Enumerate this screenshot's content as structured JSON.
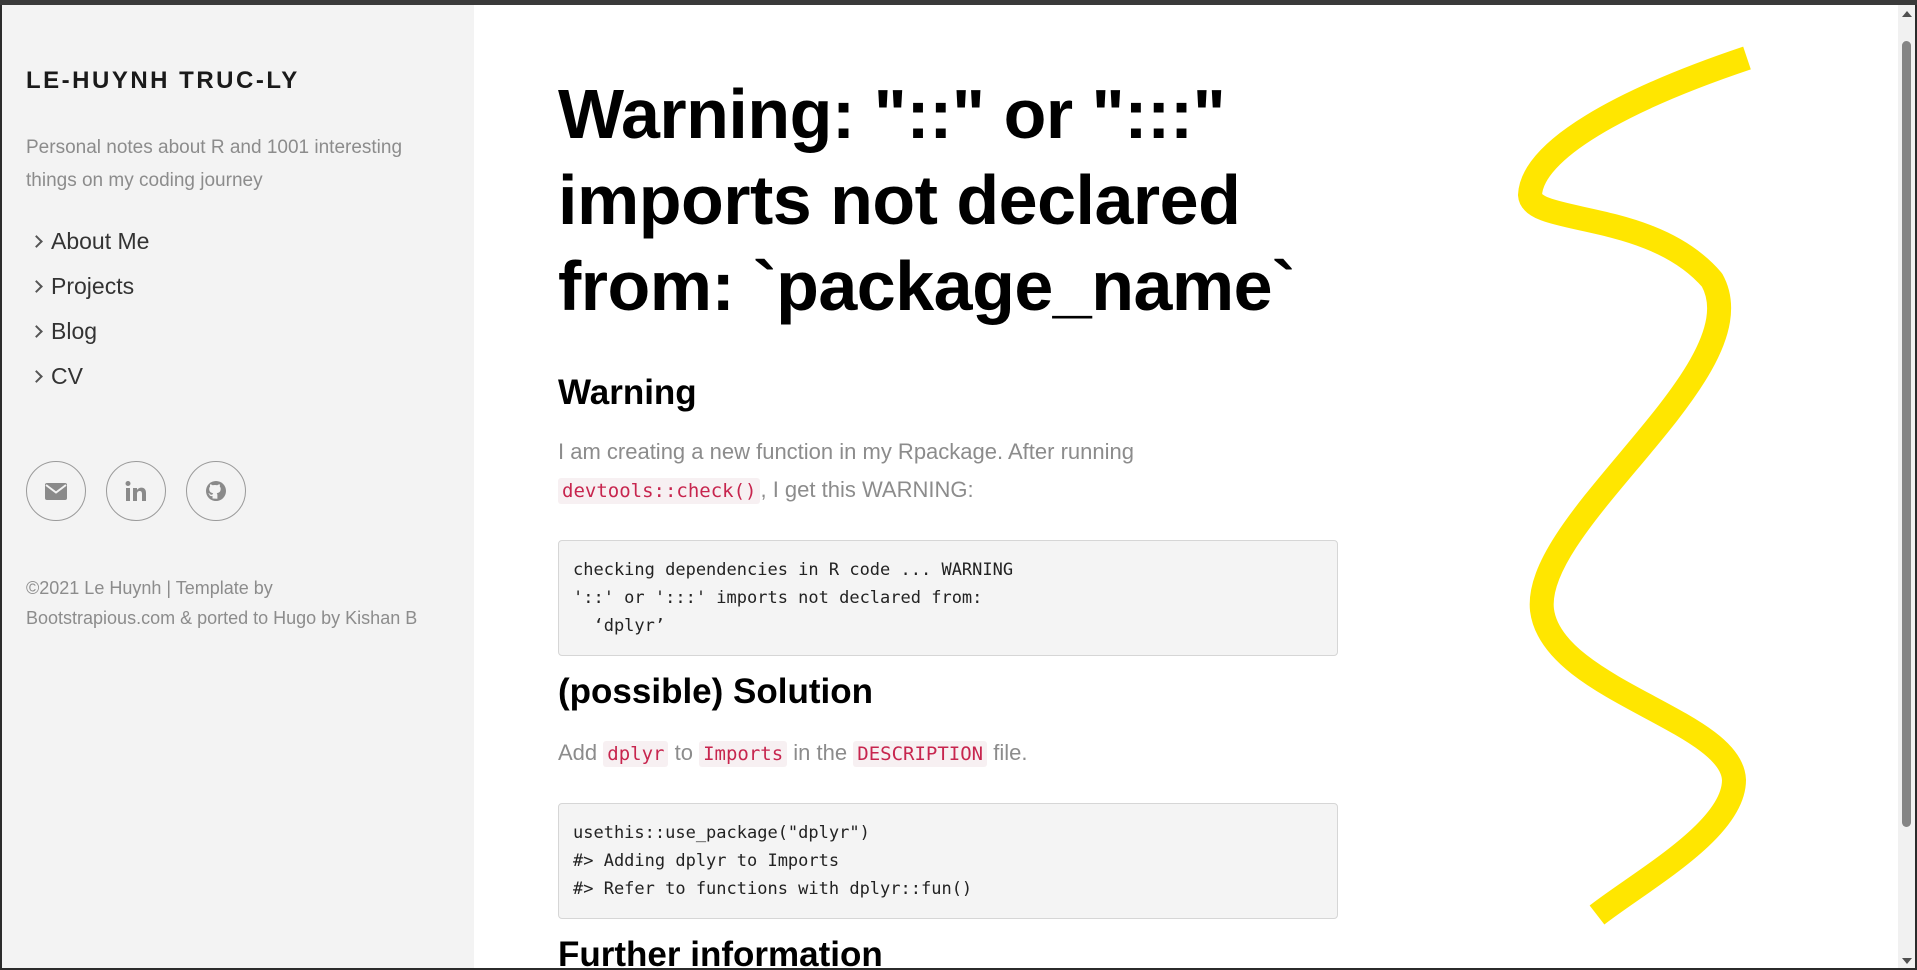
{
  "sidebar": {
    "site_title": "LE-HUYNH TRUC-LY",
    "tagline": "Personal notes about R and 1001 interesting things on my coding journey",
    "nav": [
      {
        "label": "About Me"
      },
      {
        "label": "Projects"
      },
      {
        "label": "Blog"
      },
      {
        "label": "CV"
      }
    ],
    "socials": [
      {
        "icon": "envelope-icon"
      },
      {
        "icon": "linkedin-icon"
      },
      {
        "icon": "github-icon"
      }
    ],
    "footer": "©2021 Le Huynh | Template by Bootstrapious.com & ported to Hugo by Kishan B"
  },
  "post": {
    "title": "Warning: \"::\" or \":::\" imports not declared from: `package_name`",
    "warning_heading": "Warning",
    "warning_text_1": "I am creating a new function in my Rpackage. After running",
    "warning_code": "devtools::check()",
    "warning_text_2": ", I get this WARNING:",
    "warning_block": "checking dependencies in R code ... WARNING\n'::' or ':::' imports not declared from:\n  ‘dplyr’",
    "solution_heading": "(possible) Solution",
    "solution_add": "Add",
    "solution_code_1": "dplyr",
    "solution_to": "to",
    "solution_code_2": "Imports",
    "solution_in": "in the",
    "solution_code_3": "DESCRIPTION",
    "solution_file": "file.",
    "solution_block": "usethis::use_package(\"dplyr\")\n#> Adding dplyr to Imports\n#> Refer to functions with dplyr::fun()",
    "further_heading": "Further information"
  },
  "colors": {
    "sidebar_bg": "#f3f3f3",
    "muted_text": "#8c8c8c",
    "code_red": "#c7254e",
    "squiggle_yellow": "#ffe600"
  }
}
